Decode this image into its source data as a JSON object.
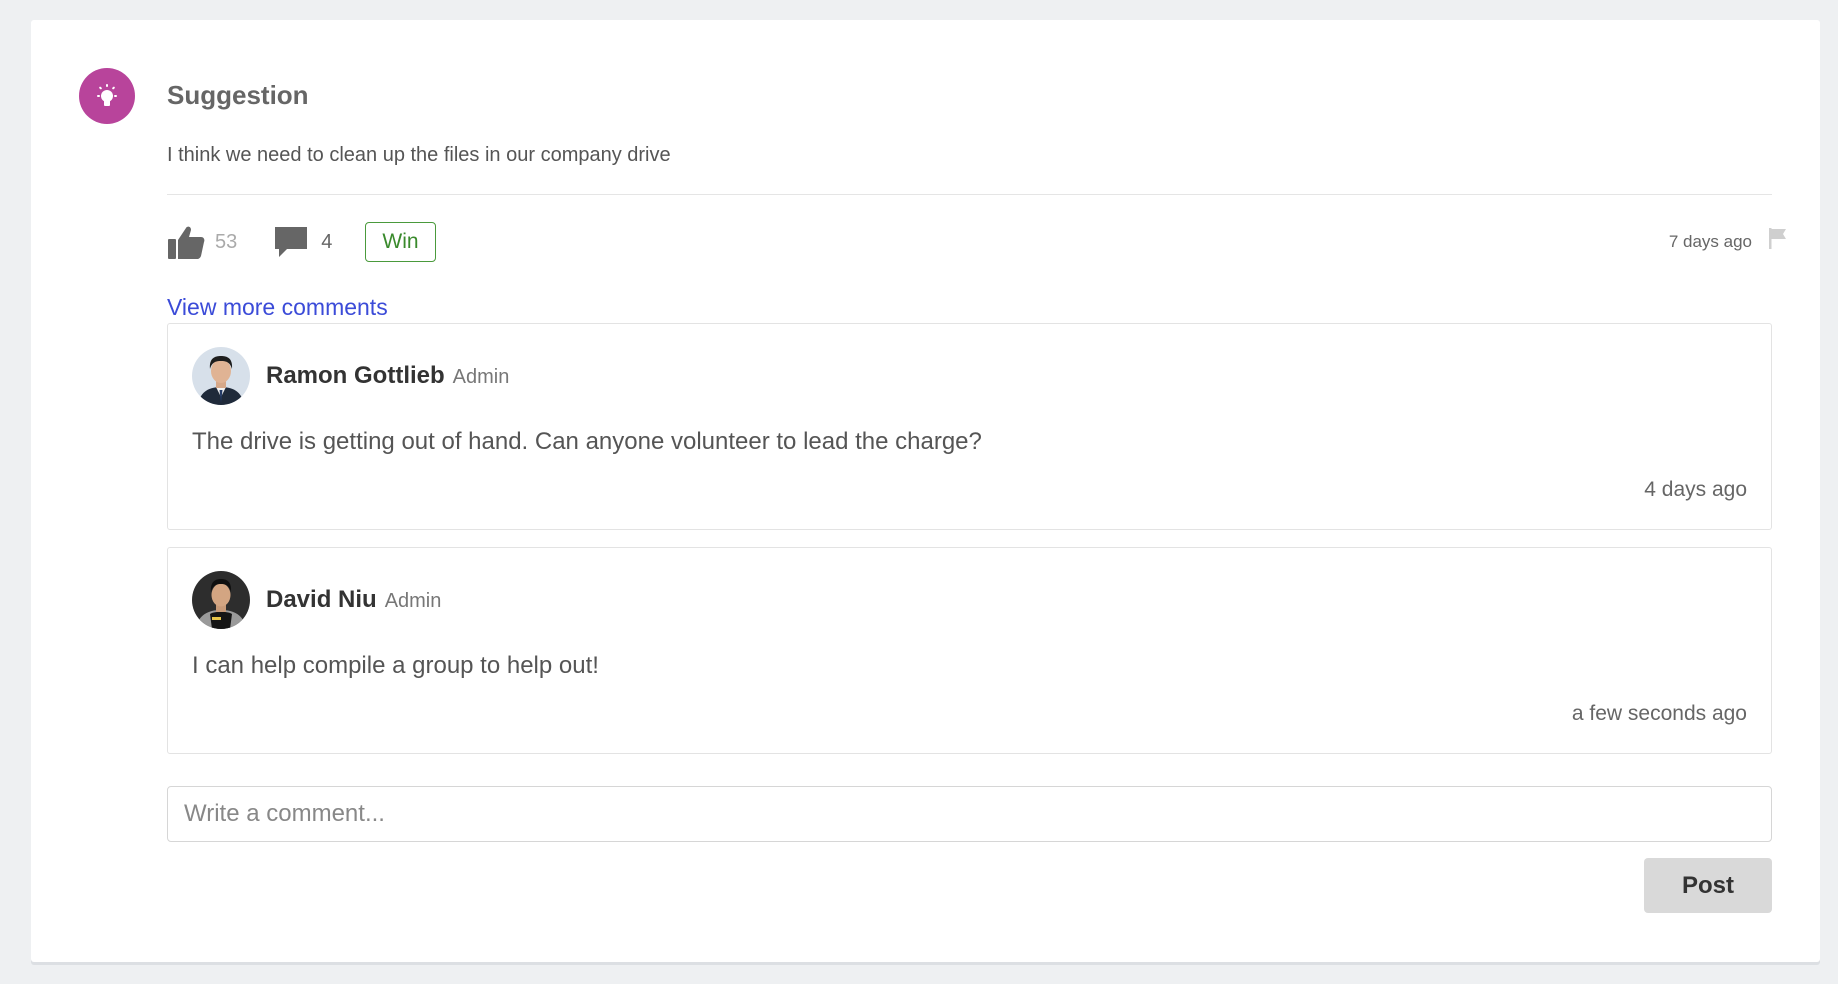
{
  "post": {
    "type_label": "Suggestion",
    "type_icon": "lightbulb-icon",
    "type_color": "#b8449b",
    "body": "I think we need to clean up the files in our company drive",
    "likes": "53",
    "comments_count": "4",
    "badge": "Win",
    "badge_color": "#3a8a2c",
    "time": "7 days ago"
  },
  "view_more_label": "View more comments",
  "comments": [
    {
      "author": "Ramon Gottlieb",
      "role": "Admin",
      "text": "The drive is getting out of hand. Can anyone volunteer to lead the charge?",
      "time": "4 days ago"
    },
    {
      "author": "David Niu",
      "role": "Admin",
      "text": "I can help compile a group to help out!",
      "time": "a few seconds ago"
    }
  ],
  "composer": {
    "placeholder": "Write a comment...",
    "value": "",
    "post_label": "Post"
  }
}
